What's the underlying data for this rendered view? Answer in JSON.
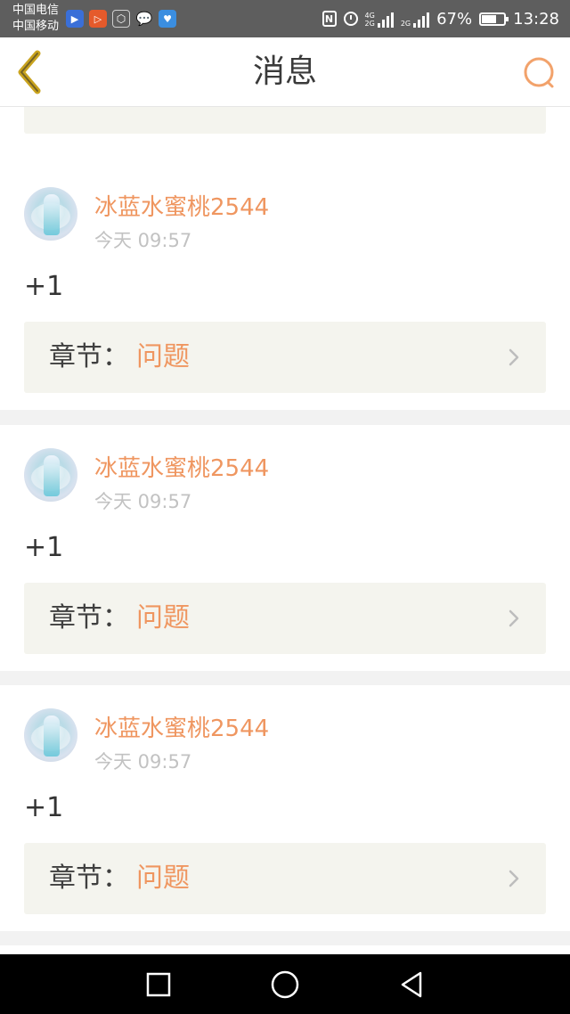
{
  "status_bar": {
    "carrier_1": "中国电信",
    "carrier_2": "中国移动",
    "app_icons": [
      "video-app-icon",
      "play-app-icon",
      "hex-app-icon",
      "wechat-icon",
      "heart-app-icon"
    ],
    "nfc_label": "N",
    "network_1": "4G",
    "network_2": "2G",
    "battery_percent": "67%",
    "battery_level": 0.67,
    "time": "13:28"
  },
  "header": {
    "title": "消息",
    "back_icon": "chevron-left-icon",
    "search_icon": "search-icon"
  },
  "colors": {
    "accent": "#ef9660",
    "back_arrow": "#c9a31e",
    "chapter_bg": "#f4f4ee",
    "status_bar_bg": "#5e5e5e",
    "page_bg": "#f2f2f2"
  },
  "messages": [
    {
      "username": "冰蓝水蜜桃2544",
      "time": "今天 09:57",
      "text": "+1",
      "chapter_label": "章节：",
      "chapter_value": "问题"
    },
    {
      "username": "冰蓝水蜜桃2544",
      "time": "今天 09:57",
      "text": "+1",
      "chapter_label": "章节：",
      "chapter_value": "问题"
    },
    {
      "username": "冰蓝水蜜桃2544",
      "time": "今天 09:57",
      "text": "+1",
      "chapter_label": "章节：",
      "chapter_value": "问题"
    }
  ],
  "nav": {
    "recent_icon": "square-icon",
    "home_icon": "circle-icon",
    "back_icon": "triangle-back-icon"
  }
}
